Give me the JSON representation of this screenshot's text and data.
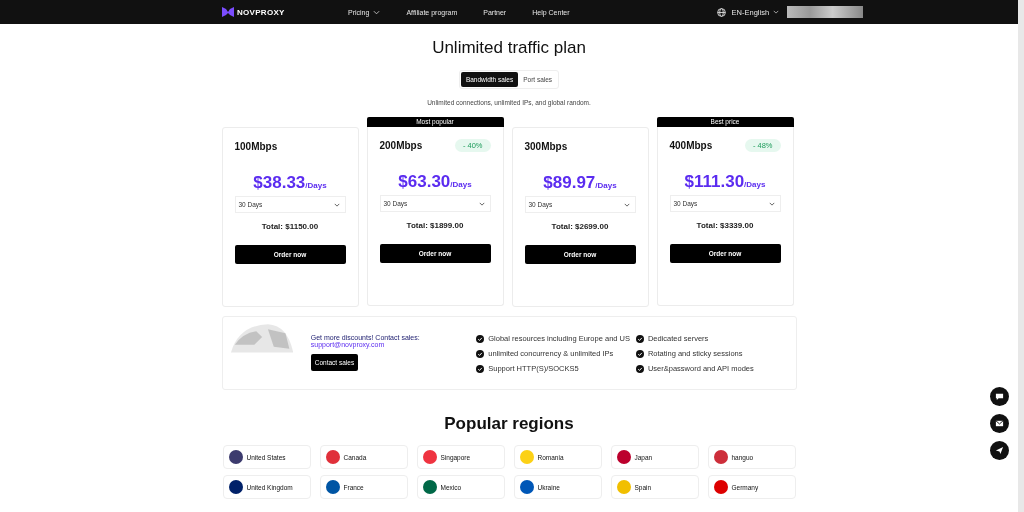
{
  "header": {
    "logo": "NOVPROXY",
    "nav": [
      {
        "label": "Pricing",
        "dropdown": true
      },
      {
        "label": "Affiliate program",
        "dropdown": false
      },
      {
        "label": "Partner",
        "dropdown": false
      },
      {
        "label": "Help Center",
        "dropdown": false
      }
    ],
    "language": "EN-English"
  },
  "title": "Unlimited traffic plan",
  "tabs": [
    {
      "label": "Bandwidth sales",
      "selected": true
    },
    {
      "label": "Port sales",
      "selected": false
    }
  ],
  "subtitle": "Unlimited connections, unlimited IPs, and global random.",
  "plans": [
    {
      "name": "100Mbps",
      "price": "$38.33",
      "unit": "/Days",
      "period": "30 Days",
      "total": "Total: $1150.00",
      "button": "Order now"
    },
    {
      "ribbon": "Most popular",
      "name": "200Mbps",
      "discount": "- 40%",
      "price": "$63.30",
      "unit": "/Days",
      "period": "30 Days",
      "total": "Total: $1899.00",
      "button": "Order now"
    },
    {
      "name": "300Mbps",
      "price": "$89.97",
      "unit": "/Days",
      "period": "30 Days",
      "total": "Total: $2699.00",
      "button": "Order now"
    },
    {
      "ribbon": "Best price",
      "name": "400Mbps",
      "discount": "- 48%",
      "price": "$111.30",
      "unit": "/Days",
      "period": "30 Days",
      "total": "Total: $3339.00",
      "button": "Order now"
    }
  ],
  "contact": {
    "heading": "Get more discounts! Contact sales:",
    "email": "support@novproxy.com",
    "button": "Contact sales"
  },
  "features": [
    [
      "Global resources including Europe and US",
      "unlimited concurrency & unlimited IPs",
      "Support HTTP(S)/SOCKS5"
    ],
    [
      "Dedicated servers",
      "Rotating and sticky sessions",
      "User&password and API modes"
    ]
  ],
  "regions_title": "Popular regions",
  "regions": [
    {
      "name": "United States",
      "color": "#3c3b6e"
    },
    {
      "name": "Canada",
      "color": "#e0303a"
    },
    {
      "name": "Singapore",
      "color": "#ef3340"
    },
    {
      "name": "Romania",
      "color": "#fcd116"
    },
    {
      "name": "Japan",
      "color": "#bc002d"
    },
    {
      "name": "hanguo",
      "color": "#cd2e3a"
    },
    {
      "name": "United Kingdom",
      "color": "#012169"
    },
    {
      "name": "France",
      "color": "#0055a4"
    },
    {
      "name": "Mexico",
      "color": "#006847"
    },
    {
      "name": "Ukraine",
      "color": "#0057b7"
    },
    {
      "name": "Spain",
      "color": "#f1bf00"
    },
    {
      "name": "Germany",
      "color": "#dd0000"
    }
  ]
}
